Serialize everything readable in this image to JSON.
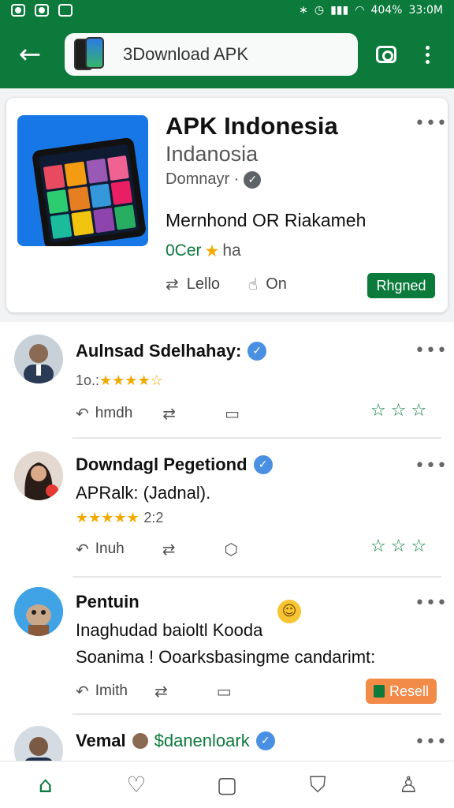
{
  "status_bar": {
    "battery": "404%",
    "time": "33:0M"
  },
  "search": {
    "query": "3Download APK"
  },
  "app_card": {
    "title": "APK Indonesia",
    "subtitle": "Indanosia",
    "developer": "Domnayr ·",
    "description": "Mernhond OR Riakameh",
    "rating_label": "0Cer",
    "rating_suffix": "ha",
    "action_like": "Lello",
    "action_share": "On",
    "install_label": "Rhgned"
  },
  "posts": [
    {
      "author": "Aulnsad Sdelhahay:",
      "rating_prefix": "1o.:",
      "stars": "★★★★☆",
      "action_reply": "hmdh"
    },
    {
      "author": "Downdagl Pegetiond",
      "text": "APRalk: (Jadnal).",
      "stars": "★★★★★",
      "rating_value": "2:2",
      "action_reply": "Inuh"
    },
    {
      "author": "Pentuin",
      "text_line1": "Inaghudad baioltl Kooda",
      "text_line2": "Soanima ! Ooarksbasingme candarimt:",
      "action_reply": "Imith",
      "chip_label": "Resell"
    },
    {
      "author": "Vemal",
      "handle": "$danenloark"
    }
  ],
  "colors": {
    "brand_green": "#0b7a3b",
    "star_gold": "#f2a900",
    "verified_blue": "#4a90e2",
    "chip_orange": "#f28b48"
  },
  "icons": {
    "back": "arrow-left-icon",
    "camera": "camera-icon",
    "more": "more-vert-icon",
    "home": "home-icon",
    "chat": "chat-icon",
    "square": "square-icon",
    "inbox": "inbox-icon",
    "profile": "profile-icon"
  }
}
